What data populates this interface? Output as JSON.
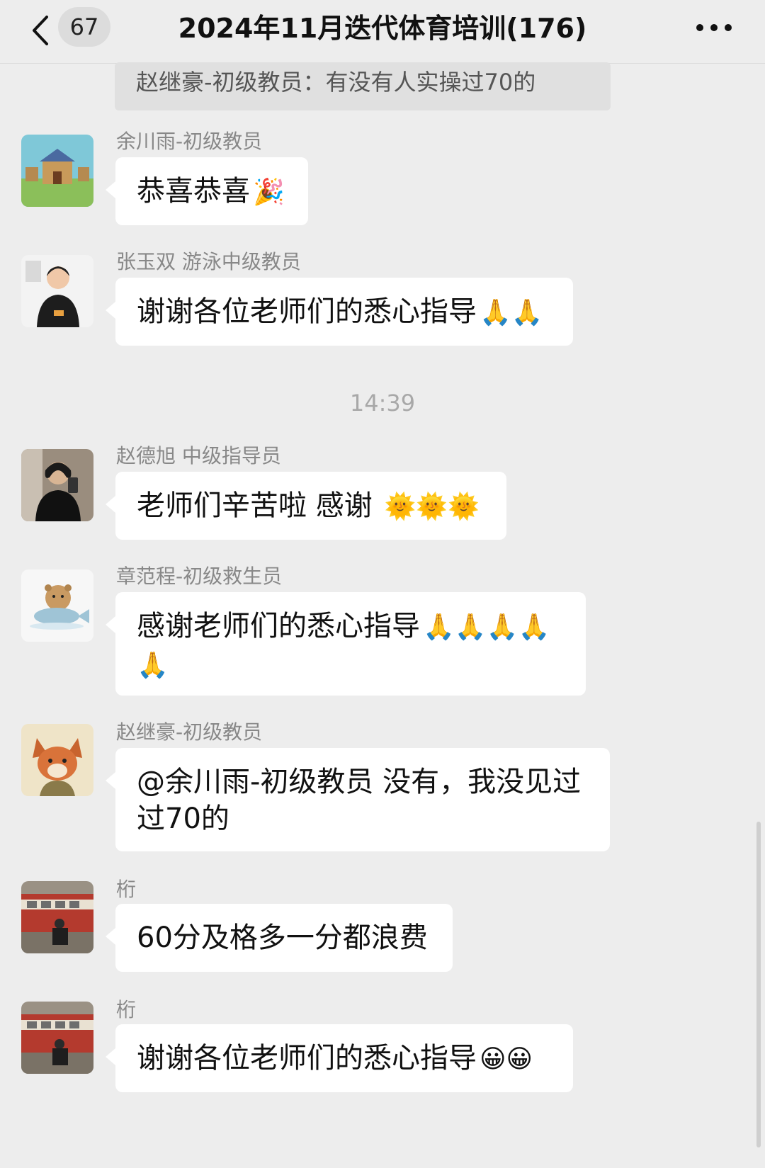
{
  "header": {
    "back_badge": "67",
    "title": "2024年11月迭代体育培训(176)"
  },
  "quoted_message": "赵继豪-初级教员：有没有人实操过70的",
  "time_divider": "14:39",
  "messages": [
    {
      "sender": "余川雨-初级教员",
      "text": "恭喜恭喜",
      "emoji": "🎉",
      "avatar": "house-scene-avatar"
    },
    {
      "sender": "张玉双 游泳中级教员",
      "text": "谢谢各位老师们的悉心指导",
      "emoji": "🙏🙏",
      "avatar": "woman-portrait-avatar"
    },
    {
      "sender": "赵德旭 中级指导员",
      "text": "老师们辛苦啦 感谢 ",
      "emoji": "🌞🌞🌞",
      "avatar": "mirror-selfie-avatar"
    },
    {
      "sender": "章范程-初级救生员",
      "text": "感谢老师们的悉心指导",
      "emoji": "🙏🙏🙏🙏",
      "emoji_line2": "🙏",
      "avatar": "capybara-fish-avatar"
    },
    {
      "sender": "赵继豪-初级教员",
      "text": "@余川雨-初级教员 没有，我没见过",
      "text_line2": "过70的",
      "avatar": "fox-cartoon-avatar"
    },
    {
      "sender": "桁",
      "text": "60分及格多一分都浪费",
      "avatar": "bus-photo-avatar"
    },
    {
      "sender": "桁",
      "text": "谢谢各位老师们的悉心指导",
      "emoji": "😀😀",
      "avatar": "bus-photo-avatar"
    }
  ],
  "colors": {
    "background": "#ededed",
    "bubble": "#ffffff",
    "sender_text": "#888888",
    "time_text": "#a8a8a8"
  }
}
